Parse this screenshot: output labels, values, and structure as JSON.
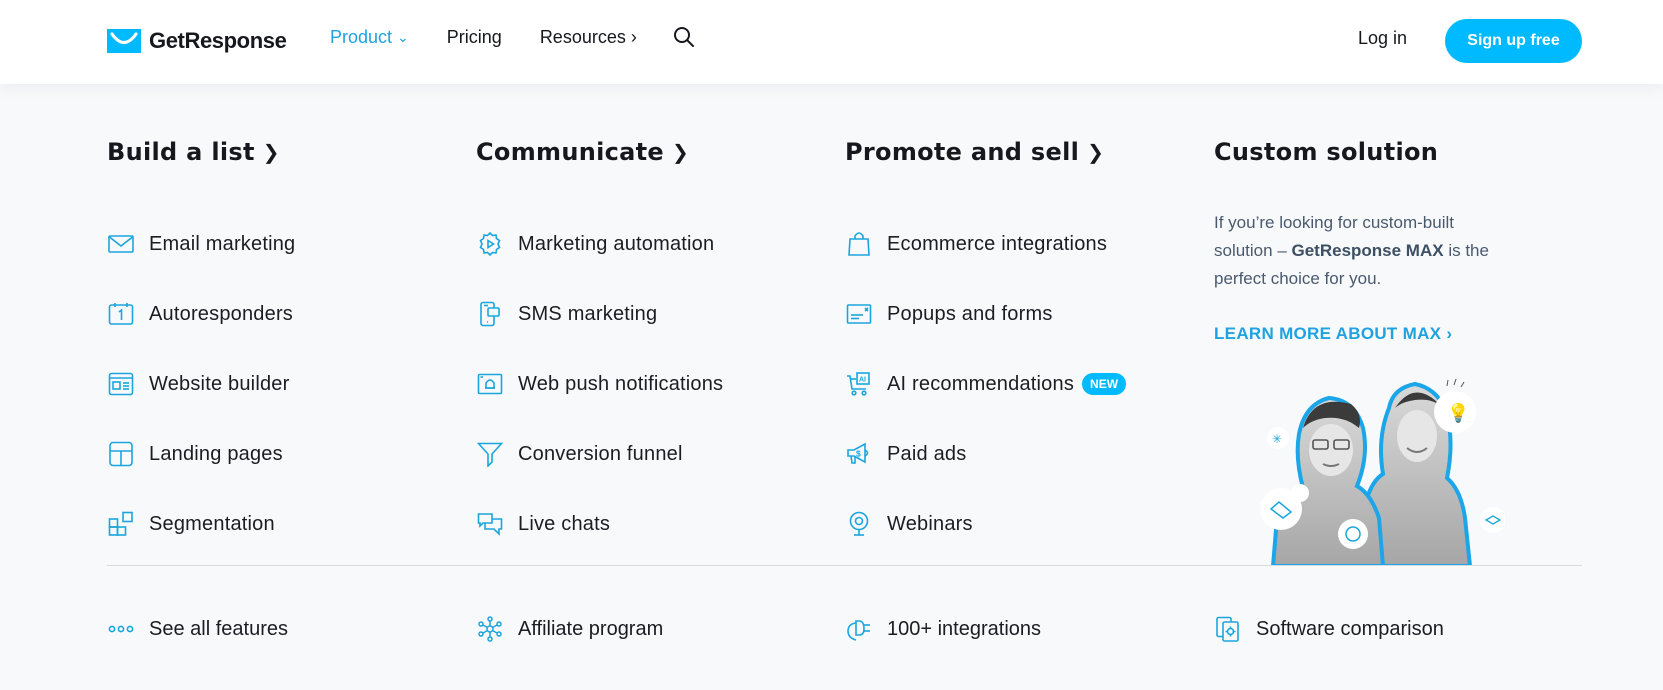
{
  "header": {
    "logo_text": "GetResponse",
    "nav": [
      {
        "label": "Product",
        "suffix": "⌄",
        "active": true
      },
      {
        "label": "Pricing",
        "suffix": ""
      },
      {
        "label": "Resources",
        "suffix": "›"
      }
    ],
    "login_label": "Log in",
    "signup_label": "Sign up free"
  },
  "colors": {
    "accent": "#00baff",
    "accent_text": "#1ea2e0",
    "text": "#16181d",
    "background": "#f8f9fb"
  },
  "columns": [
    {
      "title": "Build a list",
      "arrow": "❯",
      "items": [
        {
          "label": "Email marketing",
          "icon": "envelope-icon"
        },
        {
          "label": "Autoresponders",
          "icon": "calendar-icon"
        },
        {
          "label": "Website builder",
          "icon": "website-icon"
        },
        {
          "label": "Landing pages",
          "icon": "layout-icon"
        },
        {
          "label": "Segmentation",
          "icon": "segmentation-icon"
        }
      ]
    },
    {
      "title": "Communicate",
      "arrow": "❯",
      "items": [
        {
          "label": "Marketing automation",
          "icon": "gear-play-icon"
        },
        {
          "label": "SMS marketing",
          "icon": "phone-message-icon"
        },
        {
          "label": "Web push notifications",
          "icon": "browser-bell-icon"
        },
        {
          "label": "Conversion funnel",
          "icon": "funnel-icon"
        },
        {
          "label": "Live chats",
          "icon": "chat-bubbles-icon"
        }
      ]
    },
    {
      "title": "Promote and sell",
      "arrow": "❯",
      "items": [
        {
          "label": "Ecommerce integrations",
          "icon": "shopping-bag-icon"
        },
        {
          "label": "Popups and forms",
          "icon": "popup-icon"
        },
        {
          "label": "AI recommendations",
          "icon": "ai-cart-icon",
          "badge": "NEW"
        },
        {
          "label": "Paid ads",
          "icon": "megaphone-dollar-icon"
        },
        {
          "label": "Webinars",
          "icon": "webcam-icon"
        }
      ]
    }
  ],
  "custom": {
    "title": "Custom solution",
    "desc_part1": "If you’re looking for custom-built solution – ",
    "desc_bold": "GetResponse MAX",
    "desc_part2": " is the perfect choice for you.",
    "link_label": "LEARN MORE ABOUT MAX ›",
    "image_alt": "Two smiling people with floating icons"
  },
  "bottom": [
    {
      "label": "See all features",
      "icon": "dots-icon"
    },
    {
      "label": "Affiliate program",
      "icon": "network-icon"
    },
    {
      "label": "100+ integrations",
      "icon": "plug-icon"
    },
    {
      "label": "Software comparison",
      "icon": "compare-docs-icon"
    }
  ]
}
